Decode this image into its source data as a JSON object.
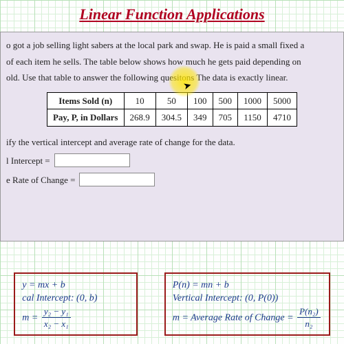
{
  "title": "Linear Function Applications",
  "problem": {
    "line1": "o got a job selling light sabers at the local park and swap. He is paid a small fixed a",
    "line2": "of each item he sells. The table below shows how much he gets paid depending on",
    "line3": "old. Use that table to answer the following quesitons The data is exactly linear.",
    "table": {
      "row1_label": "Items Sold (n)",
      "row2_label": "Pay, P, in Dollars",
      "cols": [
        "10",
        "50",
        "100",
        "500",
        "1000",
        "5000"
      ],
      "vals": [
        "268.9",
        "304.5",
        "349",
        "705",
        "1150",
        "4710"
      ]
    },
    "subq": "ify the vertical intercept and average rate of change for the data.",
    "field1_label": "l Intercept =",
    "field2_label": "e Rate of Change ="
  },
  "formulas": {
    "left": {
      "l1": "y = mx + b",
      "l2": "cal Intercept: (0, b)",
      "l3_lhs": "m =",
      "l3_num": "y₂ − y₁",
      "l3_den": "x₂ − x₁"
    },
    "right": {
      "l1": "P(n) = mn + b",
      "l2": "Vertical Intercept: (0, P(0))",
      "l3_lhs": "m = Average Rate of Change =",
      "l3_num": "P(n₂)",
      "l3_den": "n₂"
    }
  },
  "chart_data": {
    "type": "table",
    "title": "Pay vs Items Sold (linear)",
    "columns": [
      "Items Sold (n)",
      "Pay, P, in Dollars"
    ],
    "rows": [
      [
        10,
        268.9
      ],
      [
        50,
        304.5
      ],
      [
        100,
        349
      ],
      [
        500,
        705
      ],
      [
        1000,
        1150
      ],
      [
        5000,
        4710
      ]
    ],
    "xlabel": "Items Sold (n)",
    "ylabel": "Pay (Dollars)"
  }
}
